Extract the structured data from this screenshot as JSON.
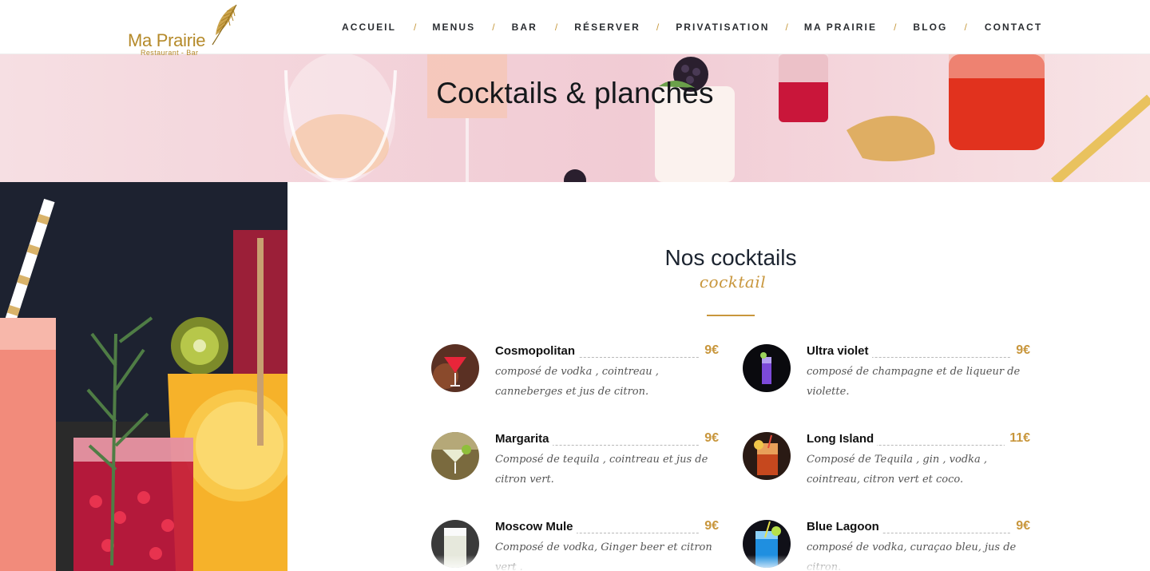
{
  "header": {
    "logo": {
      "name": "Ma Prairie",
      "subtitle": "Restaurant - Bar",
      "icon": "feather-leaf-icon",
      "color": "#b58a2a"
    },
    "nav": [
      {
        "label": "ACCUEIL"
      },
      {
        "label": "MENUS"
      },
      {
        "label": "BAR"
      },
      {
        "label": "RÉSERVER"
      },
      {
        "label": "PRIVATISATION"
      },
      {
        "label": "MA PRAIRIE"
      },
      {
        "label": "BLOG"
      },
      {
        "label": "CONTACT"
      }
    ],
    "separator": "/"
  },
  "banner": {
    "title": "Cocktails & planches"
  },
  "section": {
    "title": "Nos cocktails",
    "script": "cocktail",
    "accent_color": "#c8963c"
  },
  "items": [
    {
      "name": "Cosmopolitan",
      "price": "9€",
      "description": "composé de vodka , cointreau , canneberges et jus de citron.",
      "icon": "cosmopolitan-cocktail-icon"
    },
    {
      "name": "Ultra violet",
      "price": "9€",
      "description": "composé de champagne et de liqueur de violette.",
      "icon": "ultra-violet-cocktail-icon"
    },
    {
      "name": "Margarita",
      "price": "9€",
      "description": "Composé de tequila , cointreau et jus de citron vert.",
      "icon": "margarita-cocktail-icon"
    },
    {
      "name": "Long Island",
      "price": "11€",
      "description": "Composé de Tequila , gin , vodka , cointreau, citron vert et coco.",
      "icon": "long-island-cocktail-icon"
    },
    {
      "name": "Moscow Mule",
      "price": "9€",
      "description": "Composé de vodka, Ginger beer et citron vert .",
      "icon": "moscow-mule-cocktail-icon"
    },
    {
      "name": "Blue Lagoon",
      "price": "9€",
      "description": "composé de vodka, curaçao bleu, jus de citron.",
      "icon": "blue-lagoon-cocktail-icon"
    }
  ]
}
